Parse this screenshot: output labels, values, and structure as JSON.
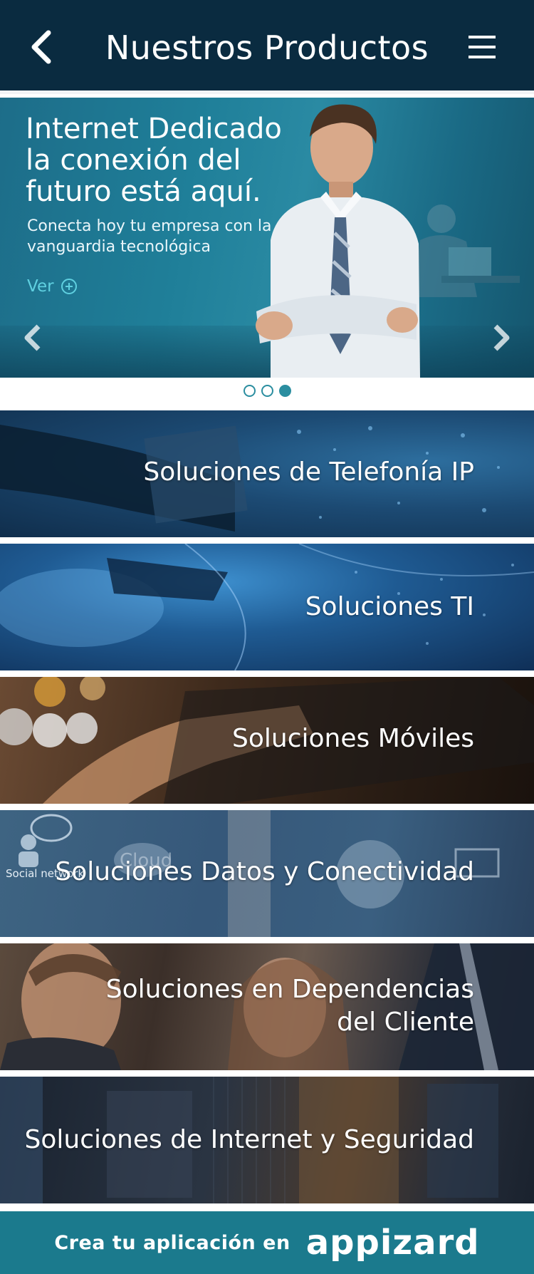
{
  "header": {
    "title": "Nuestros Productos",
    "back_icon": "chevron-left-icon",
    "menu_icon": "hamburger-menu-icon"
  },
  "hero": {
    "title_line1": "Internet Dedicado",
    "title_line2": "la conexión del",
    "title_line3": "futuro está aquí.",
    "subtitle_line1": "Conecta hoy tu empresa con la",
    "subtitle_line2": "vanguardia tecnológica",
    "link_label": "Ver",
    "link_icon": "plus-circle-icon",
    "prev_icon": "chevron-left-icon",
    "next_icon": "chevron-right-icon",
    "slide_count": 3,
    "active_slide": 3
  },
  "categories": [
    {
      "label": "Soluciones de Telefonía IP"
    },
    {
      "label": "Soluciones TI"
    },
    {
      "label": "Soluciones Móviles"
    },
    {
      "label": "Soluciones Datos y Conectividad",
      "decor_left": "Social network",
      "decor_mid": "Cloud"
    },
    {
      "label_line1": "Soluciones en Dependencias",
      "label_line2": "del Cliente"
    },
    {
      "label": "Soluciones de Internet y Seguridad"
    }
  ],
  "footer": {
    "text": "Crea tu aplicación en",
    "brand": "appizard"
  },
  "colors": {
    "header_bg": "#0a2b40",
    "accent": "#2b8ea0",
    "footer_bg": "#1b7a8d",
    "hero_link": "#5fd0e0"
  }
}
